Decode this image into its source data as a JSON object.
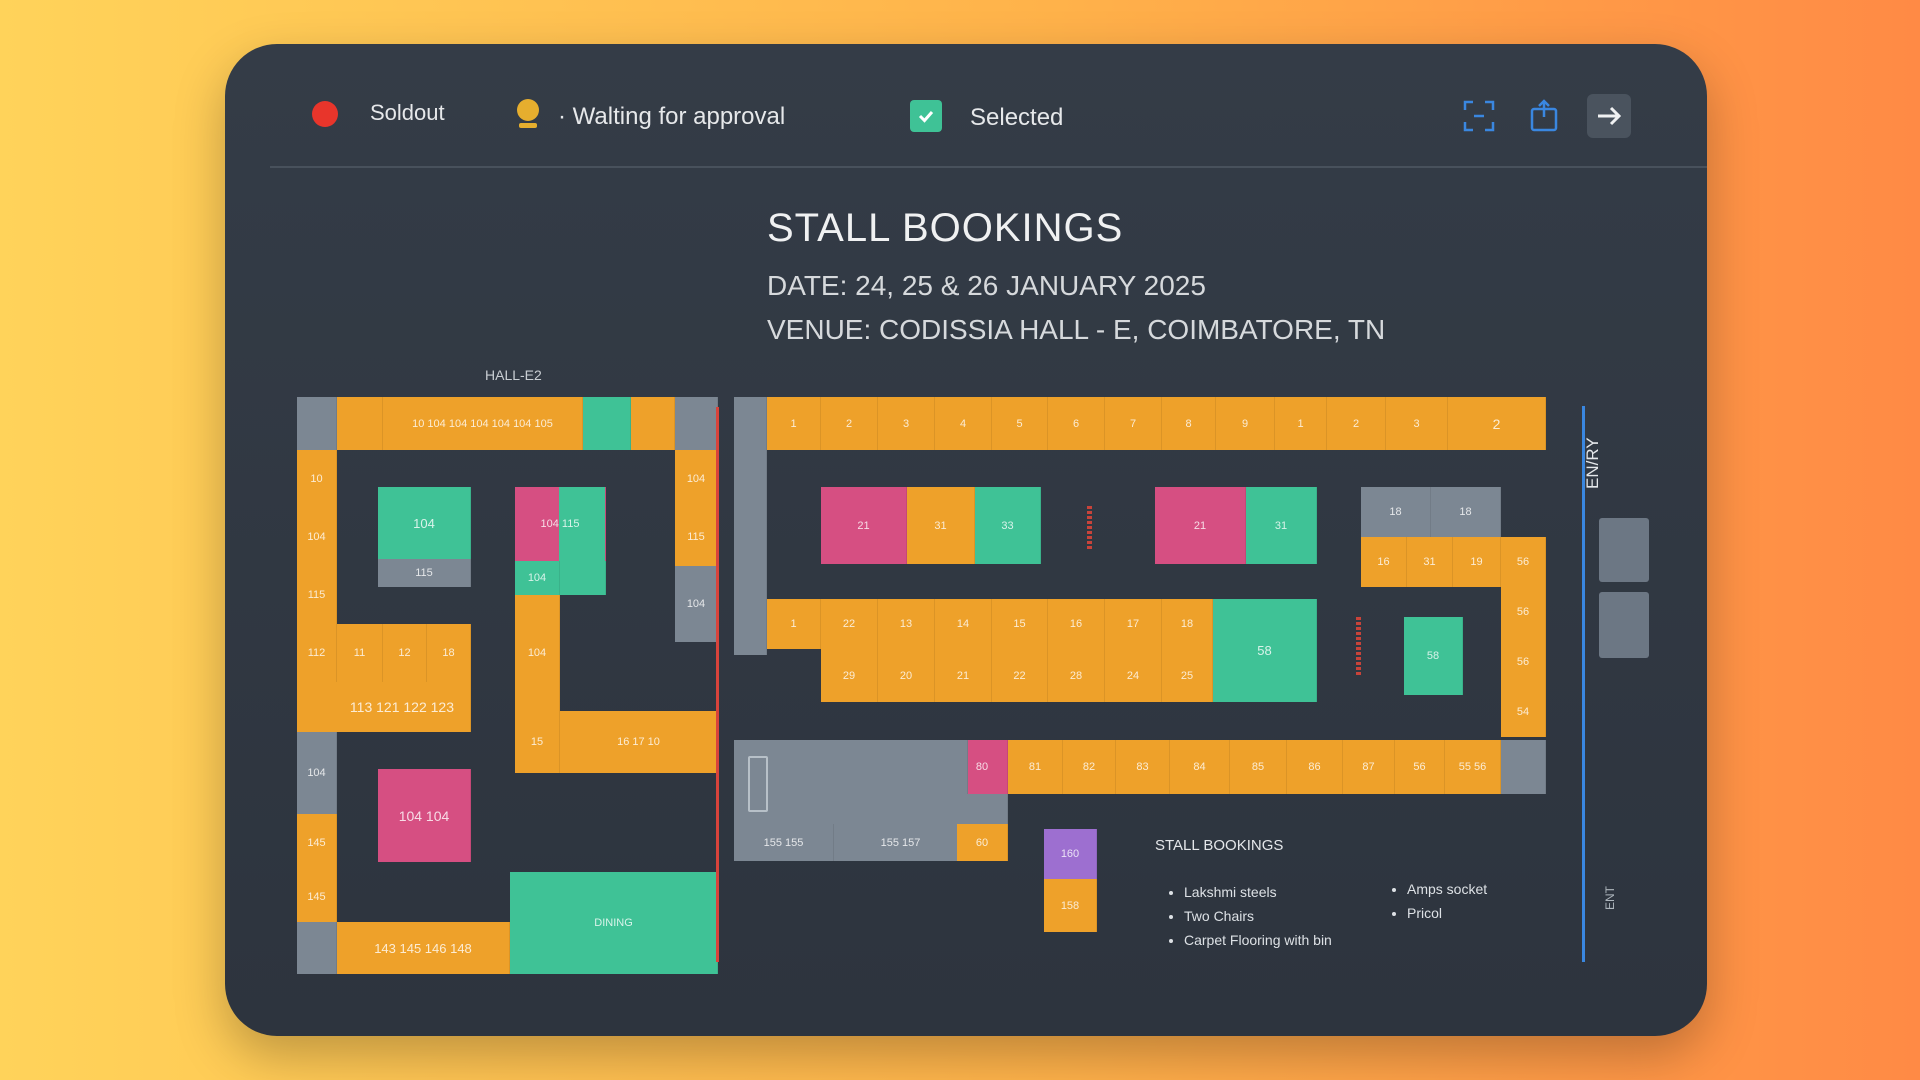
{
  "legend": {
    "soldout": "Soldout",
    "waiting": "· Walting for approval",
    "selected": "Selected",
    "colors": {
      "soldout": "#e8352b",
      "waiting": "#e6ae2e",
      "selected": "#3fc296"
    }
  },
  "toolbar": {
    "icons": [
      "scan-icon",
      "share-icon",
      "arrow-right-icon"
    ]
  },
  "header": {
    "title": "STALL BOOKINGS",
    "date": "DATE: 24, 25 & 26 JANUARY 2025",
    "venue": "VENUE: CODISSIA HALL - E, COIMBATORE, TN"
  },
  "map": {
    "hall_label": "HALL-E2",
    "entry_label": "EN/RY",
    "ent_label": "ENT",
    "dining_label": "DINING",
    "hall_e2": {
      "top_row": "10 104 104 104 104 104 105",
      "left_col": [
        "10",
        "104",
        "115"
      ],
      "box1": "104",
      "box1_sub": "115",
      "box2_a": "104 115",
      "box2_b": "104",
      "right_col": [
        "104",
        "115",
        "104"
      ],
      "row_small": [
        "112",
        "11",
        "12",
        "18"
      ],
      "row_big": "113 121 122 123",
      "mid_col": "104",
      "mid_row": [
        "15",
        "16 17 10"
      ],
      "left_low": [
        "104",
        "145",
        "145"
      ],
      "pink_big": "104 104",
      "bottom_row": "143 145 146 148"
    },
    "hall_e": {
      "top_row": [
        "1",
        "2",
        "3",
        "4",
        "5",
        "6",
        "7",
        "8",
        "9",
        "1",
        "2",
        "3",
        "2"
      ],
      "block1": [
        "21",
        "31",
        "33"
      ],
      "block2": [
        "21",
        "31"
      ],
      "block3_top": [
        "18",
        "18"
      ],
      "block3_row": [
        "16",
        "31",
        "19",
        "56"
      ],
      "right_col": [
        "56",
        "56",
        "54"
      ],
      "mid_top": [
        "1",
        "22",
        "13",
        "14",
        "15",
        "16",
        "17",
        "18"
      ],
      "mid_bottom": [
        "29",
        "20",
        "21",
        "22",
        "28",
        "24",
        "25"
      ],
      "mid_green": "58",
      "green_small": "58",
      "low_row": [
        "80",
        "81",
        "82",
        "83",
        "84",
        "85",
        "86",
        "87",
        "56",
        "55 56"
      ],
      "low_grey": [
        "155 155",
        "155 157"
      ],
      "small_orange": "60",
      "purple": "160",
      "orange_low": "158"
    }
  },
  "notes": {
    "title": "STALL BOOKINGS",
    "col1": [
      "Lakshmi steels",
      "Two Chairs",
      "Carpet Flooring with bin"
    ],
    "col2": [
      "Amps socket",
      "Pricol"
    ]
  }
}
